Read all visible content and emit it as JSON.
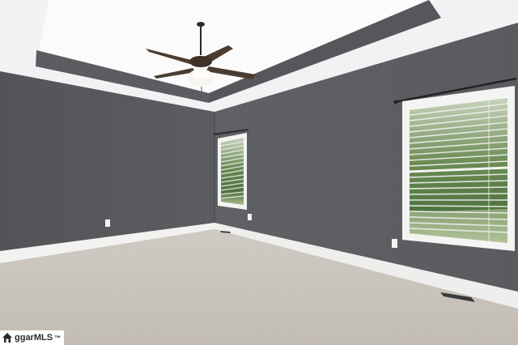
{
  "photo": {
    "subject": "empty-bedroom",
    "colors": {
      "ceiling": "#f3f4f5",
      "tray_recess": "#fbfbfb",
      "tray_band": "#5a5c60",
      "wall_left": "#55575b",
      "wall_right": "#5d5f63",
      "baseboard": "#f2f2f0",
      "carpet": "#c9c4bd",
      "window_frame": "#f4f4f2",
      "blind_slat": "#e9ebea",
      "foliage": "#5d8048",
      "fan_metal": "#4a3c30"
    },
    "icons": [
      "ceiling-fan-icon",
      "window-icon",
      "outlet-icon",
      "floor-vent-icon"
    ]
  },
  "watermark": {
    "text": "ggarMLS",
    "tm": "™"
  }
}
